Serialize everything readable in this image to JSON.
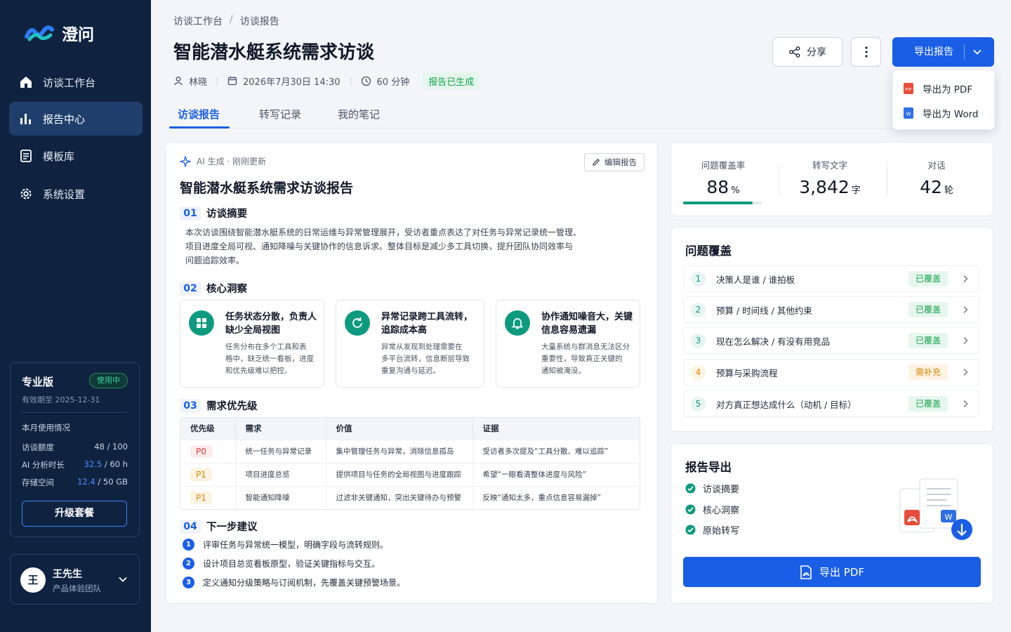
{
  "app": {
    "name": "澄问"
  },
  "sidebar": {
    "nav": [
      {
        "label": "访谈工作台",
        "icon": "home-icon"
      },
      {
        "label": "报告中心",
        "icon": "bar-chart-icon"
      },
      {
        "label": "模板库",
        "icon": "document-icon"
      },
      {
        "label": "系统设置",
        "icon": "gear-icon"
      }
    ],
    "plan": {
      "name": "专业版",
      "badge": "使用中",
      "expire": "有效期至 2025-12-31",
      "usage_title": "本月使用情况",
      "usage": [
        {
          "label": "访谈额度",
          "used": "48",
          "total": " / 100"
        },
        {
          "label": "AI 分析时长",
          "used": "32.5",
          "total": " / 60 h"
        },
        {
          "label": "存储空间",
          "used": "12.4",
          "total": " / 50 GB"
        }
      ],
      "upgrade": "升级套餐"
    },
    "user": {
      "avatar": "王",
      "name": "王先生",
      "team": "产品体验团队"
    }
  },
  "header": {
    "breadcrumb": [
      "访谈工作台",
      "访谈报告"
    ],
    "title": "智能潜水艇系统需求访谈",
    "meta": {
      "person": "林晓",
      "datetime": "2026年7月30日 14:30",
      "duration": "60 分钟",
      "status": "报告已生成"
    },
    "tabs": [
      "访谈报告",
      "转写记录",
      "我的笔记"
    ],
    "share": "分享",
    "export": "导出报告",
    "export_menu": [
      "导出为 PDF",
      "导出为 Word"
    ]
  },
  "report": {
    "ai_label": "AI 生成 · 刚刚更新",
    "edit": "编辑报告",
    "title": "智能潜水艇系统需求访谈报告",
    "sections": [
      {
        "num": "01",
        "title": "访谈摘要"
      },
      {
        "num": "02",
        "title": "核心洞察"
      },
      {
        "num": "03",
        "title": "需求优先级"
      },
      {
        "num": "04",
        "title": "下一步建议"
      }
    ],
    "summary_lines": [
      "本次访谈围绕智能潜水艇系统的日常运维与异常管理展开，受访者重点表达了对任务与异常记录统一管理、",
      "项目进度全局可视、通知降噪与关键协作的信息诉求。整体目标是减少多工具切换，提升团队协同效率与",
      "问题追踪效率。"
    ],
    "insights": [
      {
        "title": [
          "任务状态分散，负责人",
          "缺少全局视图"
        ],
        "desc": [
          "任务分布在多个工具和表",
          "格中，缺乏统一看板，进度",
          "和优先级难以把控。"
        ]
      },
      {
        "title": [
          "异常记录跨工具流转，",
          "追踪成本高"
        ],
        "desc": [
          "异常从发现到处理需要在",
          "多平台流转，信息断层导致",
          "重复沟通与延迟。"
        ]
      },
      {
        "title": [
          "协作通知噪音大，关键",
          "信息容易遗漏"
        ],
        "desc": [
          "大量系统与群消息无法区分",
          "重要性，导致真正关键的",
          "通知被淹没。"
        ]
      }
    ],
    "table": {
      "headers": [
        "优先级",
        "需求",
        "价值",
        "证据"
      ],
      "rows": [
        [
          "P0",
          "统一任务与异常记录",
          "集中管理任务与异常，消除信息孤岛",
          "受访者多次提及“工具分散、难以追踪”"
        ],
        [
          "P1",
          "项目进度总览",
          "提供项目与任务的全局视图与进度跟踪",
          "希望“一眼看清整体进度与风险”"
        ],
        [
          "P1",
          "智能通知降噪",
          "过滤非关键通知，突出关键待办与预警",
          "反映“通知太多，重点信息容易漏掉”"
        ]
      ]
    },
    "steps": [
      "评审任务与异常统一模型，明确字段与流转规则。",
      "设计项目总览看板原型，验证关键指标与交互。",
      "定义通知分级策略与订阅机制，先覆盖关键预警场景。"
    ]
  },
  "stats": [
    {
      "label": "问题覆盖率",
      "value": "88",
      "unit": "%"
    },
    {
      "label": "转写文字",
      "value": "3,842",
      "unit": "字"
    },
    {
      "label": "对话",
      "value": "42",
      "unit": "轮"
    }
  ],
  "coverage_progress": 0.88,
  "coverage": {
    "title": "问题覆盖",
    "items": [
      {
        "num": "1",
        "text": "决策人是谁 / 谁拍板",
        "status": "已覆盖"
      },
      {
        "num": "2",
        "text": "预算 / 时间线 / 其他约束",
        "status": "已覆盖"
      },
      {
        "num": "3",
        "text": "现在怎么解决 / 有没有用竞品",
        "status": "已覆盖"
      },
      {
        "num": "4",
        "text": "预算与采购流程",
        "status": "需补充"
      },
      {
        "num": "5",
        "text": "对方真正想达成什么（动机 / 目标）",
        "status": "已覆盖"
      }
    ]
  },
  "export_panel": {
    "title": "报告导出",
    "items": [
      "访谈摘要",
      "核心洞察",
      "原始转写"
    ],
    "button": "导出 PDF"
  },
  "colors": {
    "sidebar": "#0f2341",
    "primary": "#1a5ee6",
    "success": "#0d9a7f",
    "warning": "#d88a0f",
    "danger": "#e23b3b"
  }
}
